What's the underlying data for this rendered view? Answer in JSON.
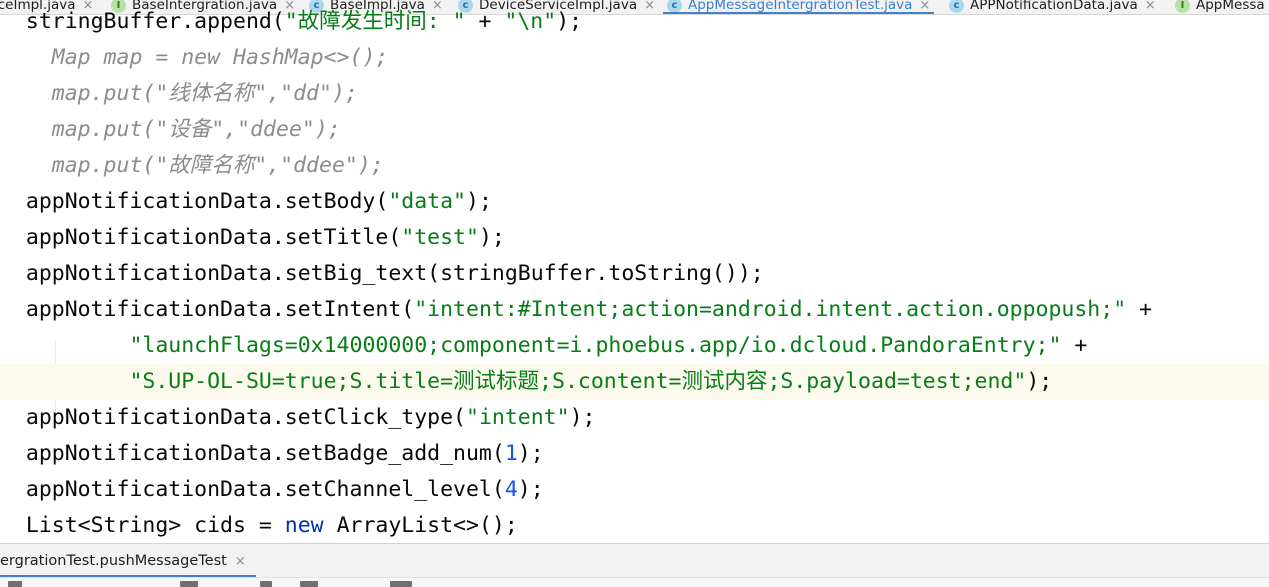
{
  "editor": {
    "tabs": [
      {
        "label": "iceImpl.java",
        "kind": "class",
        "active": false
      },
      {
        "label": "BaseIntergration.java",
        "kind": "interface",
        "active": false
      },
      {
        "label": "BaseImpl.java",
        "kind": "class",
        "active": false
      },
      {
        "label": "DeviceServiceImpl.java",
        "kind": "class",
        "active": false
      },
      {
        "label": "AppMessageIntergrationTest.java",
        "kind": "class",
        "active": true
      },
      {
        "label": "APPNotificationData.java",
        "kind": "class",
        "active": false
      },
      {
        "label": "AppMessa",
        "kind": "interface",
        "active": false
      }
    ],
    "tab_close_glyph": "×",
    "class_icon_letter": "c",
    "interface_icon_letter": "I",
    "code_lines": [
      {
        "indent": "  ",
        "tokens": [
          {
            "t": "plain",
            "v": "stringBuffer.append("
          },
          {
            "t": "str",
            "v": "\"故障发生时间: \""
          },
          {
            "t": "plain",
            "v": " + "
          },
          {
            "t": "str",
            "v": "\"\\n\""
          },
          {
            "t": "plain",
            "v": ");"
          }
        ]
      },
      {
        "indent": "    ",
        "tokens": [
          {
            "t": "comment",
            "v": "Map map = new HashMap<>();"
          }
        ]
      },
      {
        "indent": "    ",
        "tokens": [
          {
            "t": "comment",
            "v": "map.put(\"线体名称\",\"dd\");"
          }
        ]
      },
      {
        "indent": "    ",
        "tokens": [
          {
            "t": "comment",
            "v": "map.put(\"设备\",\"ddee\");"
          }
        ]
      },
      {
        "indent": "    ",
        "tokens": [
          {
            "t": "comment",
            "v": "map.put(\"故障名称\",\"ddee\");"
          }
        ]
      },
      {
        "indent": "  ",
        "tokens": [
          {
            "t": "plain",
            "v": "appNotificationData.setBody("
          },
          {
            "t": "str",
            "v": "\"data\""
          },
          {
            "t": "plain",
            "v": ");"
          }
        ]
      },
      {
        "indent": "  ",
        "tokens": [
          {
            "t": "plain",
            "v": "appNotificationData.setTitle("
          },
          {
            "t": "str",
            "v": "\"test\""
          },
          {
            "t": "plain",
            "v": ");"
          }
        ]
      },
      {
        "indent": "  ",
        "tokens": [
          {
            "t": "plain",
            "v": "appNotificationData.setBig_text(stringBuffer.toString());"
          }
        ]
      },
      {
        "indent": "  ",
        "tokens": [
          {
            "t": "plain",
            "v": "appNotificationData.setIntent("
          },
          {
            "t": "str",
            "v": "\"intent:#Intent;action=android.intent.action.oppopush;\""
          },
          {
            "t": "plain",
            "v": " +"
          }
        ]
      },
      {
        "indent": "          ",
        "tokens": [
          {
            "t": "str",
            "v": "\"launchFlags=0x14000000;component=i.phoebus.app/io.dcloud.PandoraEntry;\""
          },
          {
            "t": "plain",
            "v": " +"
          }
        ]
      },
      {
        "indent": "          ",
        "current": true,
        "tokens": [
          {
            "t": "str",
            "v": "\"S.UP-OL-SU=true;S.title=测试标题;S.content=测试内容;S.payload=test;end\""
          },
          {
            "t": "plain",
            "v": ");"
          }
        ]
      },
      {
        "indent": "  ",
        "tokens": [
          {
            "t": "plain",
            "v": "appNotificationData.setClick_type("
          },
          {
            "t": "str",
            "v": "\"intent\""
          },
          {
            "t": "plain",
            "v": ");"
          }
        ]
      },
      {
        "indent": "  ",
        "tokens": [
          {
            "t": "plain",
            "v": "appNotificationData.setBadge_add_num("
          },
          {
            "t": "num",
            "v": "1"
          },
          {
            "t": "plain",
            "v": ");"
          }
        ]
      },
      {
        "indent": "  ",
        "tokens": [
          {
            "t": "plain",
            "v": "appNotificationData.setChannel_level("
          },
          {
            "t": "num",
            "v": "4"
          },
          {
            "t": "plain",
            "v": ");"
          }
        ]
      },
      {
        "indent": "  ",
        "tokens": [
          {
            "t": "plain",
            "v": "List<String> cids = "
          },
          {
            "t": "kw",
            "v": "new"
          },
          {
            "t": "plain",
            "v": " ArrayList<>();"
          }
        ]
      }
    ]
  },
  "run_panel": {
    "tab_label": "ergrationTest.pushMessageTest",
    "tab_close_glyph": "×"
  },
  "colors": {
    "string": "#067d17",
    "number": "#1750eb",
    "keyword": "#0033b3",
    "comment": "#8c8c8c",
    "active_tab": "#3d7ed1"
  }
}
